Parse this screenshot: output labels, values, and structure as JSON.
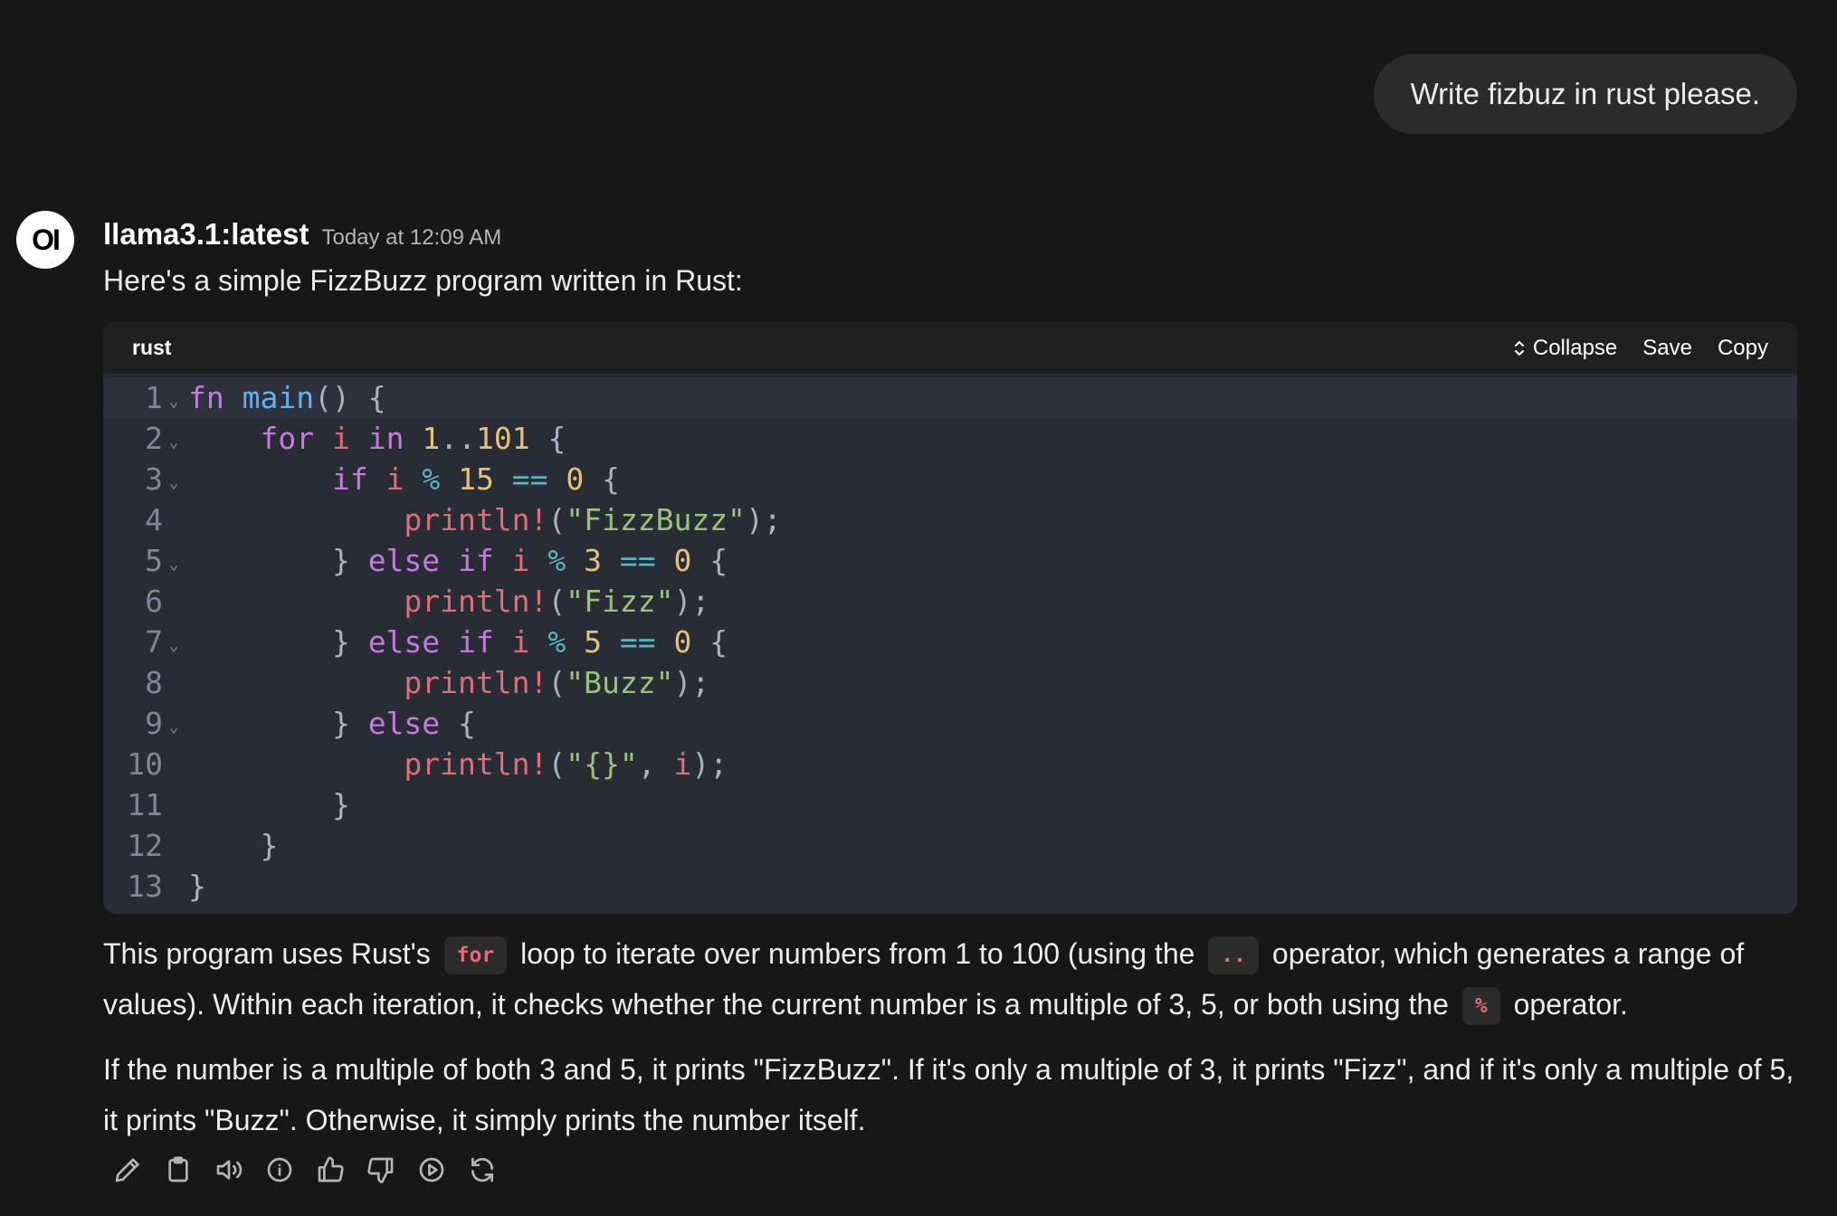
{
  "user_message": {
    "text": "Write fizbuz in rust please."
  },
  "assistant": {
    "avatar_text": "OI",
    "model_name": "llama3.1:latest",
    "timestamp": "Today at 12:09 AM",
    "intro": "Here's a simple FizzBuzz program written in Rust:",
    "code_block": {
      "language": "rust",
      "collapse_label": "Collapse",
      "save_label": "Save",
      "copy_label": "Copy",
      "line_numbers": [
        "1",
        "2",
        "3",
        "4",
        "5",
        "6",
        "7",
        "8",
        "9",
        "10",
        "11",
        "12",
        "13"
      ],
      "foldable_lines": [
        1,
        2,
        3,
        5,
        7,
        9
      ],
      "lines": [
        "fn main() {",
        "    for i in 1..101 {",
        "        if i % 15 == 0 {",
        "            println!(\"FizzBuzz\");",
        "        } else if i % 3 == 0 {",
        "            println!(\"Fizz\");",
        "        } else if i % 5 == 0 {",
        "            println!(\"Buzz\");",
        "        } else {",
        "            println!(\"{}\", i);",
        "        }",
        "    }",
        "}"
      ]
    },
    "paragraph1": {
      "part1": "This program uses Rust's",
      "code1": "for",
      "part2": "loop to iterate over numbers from 1 to 100 (using the",
      "code2": "..",
      "part3": "operator, which generates a range of values). Within each iteration, it checks whether the current number is a multiple of 3, 5, or both using the",
      "code3": "%",
      "part4": "operator."
    },
    "paragraph2": "If the number is a multiple of both 3 and 5, it prints \"FizzBuzz\". If it's only a multiple of 3, it prints \"Fizz\", and if it's only a multiple of 5, it prints \"Buzz\". Otherwise, it simply prints the number itself.",
    "actions": [
      "edit-icon",
      "copy-icon",
      "read-aloud-icon",
      "info-icon",
      "thumbs-up-icon",
      "thumbs-down-icon",
      "continue-icon",
      "regenerate-icon"
    ]
  }
}
